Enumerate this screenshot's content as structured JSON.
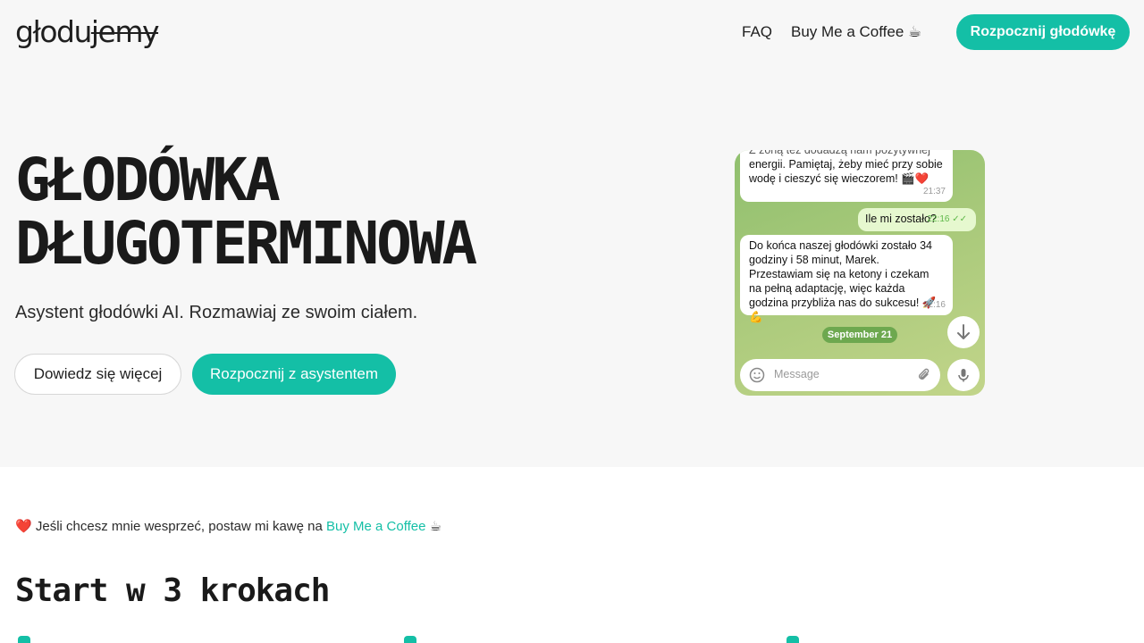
{
  "header": {
    "logo_prefix": "głodu",
    "logo_struck": "jemy",
    "nav_faq": "FAQ",
    "nav_bmc": "Buy Me a Coffee ☕",
    "cta": "Rozpocznij głodówkę"
  },
  "hero": {
    "title_line1": "GŁODÓWKA",
    "title_line2": "DŁUGOTERMINOWA",
    "subtitle": "Asystent głodówki AI. Rozmawiaj ze swoim ciałem.",
    "btn_learn": "Dowiedz się więcej",
    "btn_start": "Rozpocznij z asystentem"
  },
  "chat": {
    "msg1_partial": "Z żoną też dodadzą nam pozytywnej",
    "msg1_text": "energii. Pamiętaj, żeby mieć przy sobie wodę i cieszyć się wieczorem! 🎬❤️",
    "msg1_time": "21:37",
    "msg2_text": "Ile mi zostało?",
    "msg2_time": "22:16",
    "msg3_text": "Do końca naszej głodówki zostało 34 godziny i 58 minut, Marek. Przestawiam się na ketony i czekam na pełną adaptację, więc każda godzina przybliża nas do sukcesu! 🚀💪",
    "msg3_time": "22:16",
    "date_pill": "September 21",
    "input_placeholder": "Message"
  },
  "support": {
    "heart": "❤️",
    "text": "Jeśli chcesz mnie wesprzeć, postaw mi kawę na",
    "link": "Buy Me a Coffee",
    "emoji": "☕"
  },
  "steps": {
    "title": "Start w 3 krokach"
  },
  "colors": {
    "accent": "#14bfa6",
    "hero_bg": "#f7f7f7"
  }
}
